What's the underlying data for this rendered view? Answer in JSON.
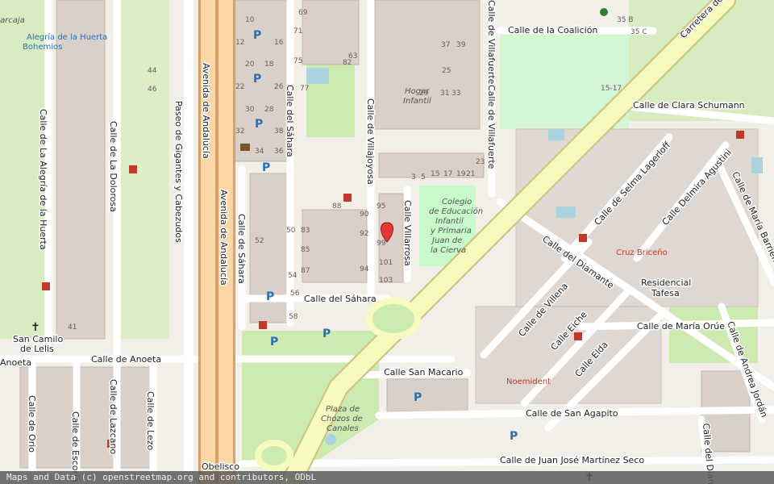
{
  "map": {
    "attribution": "Maps and Data (c) openstreetmap.org and contributors, ODbL",
    "colors": {
      "background": "#f2efe9",
      "building": "#d9d0c9",
      "building_stroke": "#c4b6ab",
      "park": "#c8facc",
      "green": "#cdebb0",
      "road_major": "#fcd6a4",
      "road_major_casing": "#d9a06b",
      "road_secondary": "#f7fabf",
      "road_minor": "#ffffff",
      "water": "#aad3df",
      "poi_red": "#c0392b",
      "poi_blue": "#2a6fb5",
      "marker": "#e53935",
      "parking": "#2a6fb5"
    },
    "streets": [
      {
        "id": "calle-de-la-coalicion",
        "text": "Calle de la Coalición"
      },
      {
        "id": "carretera",
        "text": "Carretera de"
      },
      {
        "id": "calle-de-clara-schumann",
        "text": "Calle de Clara Schumann"
      },
      {
        "id": "calle-de-villafuerte",
        "text": "Calle de Villafuerte"
      },
      {
        "id": "calle-de-villajoyosa",
        "text": "Calle de Villajoyosa"
      },
      {
        "id": "calle-villarrosa",
        "text": "Calle Villarrosa"
      },
      {
        "id": "calle-del-sahara-v",
        "text": "Calle del Sáhara"
      },
      {
        "id": "calle-de-sahara",
        "text": "Calle de Sáhara"
      },
      {
        "id": "calle-del-sahara-h",
        "text": "Calle del Sáhara"
      },
      {
        "id": "avenida-de-andalucia-1",
        "text": "Avenida de Andalucía"
      },
      {
        "id": "avenida-de-andalucia-2",
        "text": "Avenida de Andalucía"
      },
      {
        "id": "paseo-de-gigantes",
        "text": "Paseo de Gigantes y Cabezudos"
      },
      {
        "id": "calle-de-la-dolorosa",
        "text": "Calle de La Dolorosa"
      },
      {
        "id": "calle-de-la-alegria",
        "text": "Calle de La Alegría de la Huerta"
      },
      {
        "id": "calle-de-anoeta",
        "text": "Calle de Anoeta"
      },
      {
        "id": "anoeta",
        "text": "Anoeta"
      },
      {
        "id": "calle-de-orio",
        "text": "Calle de Orio"
      },
      {
        "id": "calle-de-escoriaza",
        "text": "Calle de Escoria"
      },
      {
        "id": "calle-de-lazcano",
        "text": "Calle de Lazcano"
      },
      {
        "id": "calle-de-lezo",
        "text": "Calle de Lezo"
      },
      {
        "id": "calle-san-macario",
        "text": "Calle San Macario"
      },
      {
        "id": "calle-de-san-agapito",
        "text": "Calle de San Agapito"
      },
      {
        "id": "calle-de-juan-jose",
        "text": "Calle de Juan José Martínez Seco"
      },
      {
        "id": "calle-del-diamante",
        "text": "Calle del Diamante"
      },
      {
        "id": "calle-de-villena",
        "text": "Calle de Villena"
      },
      {
        "id": "calle-eiche",
        "text": "Calle Eiche"
      },
      {
        "id": "calle-elda",
        "text": "Calle Elda"
      },
      {
        "id": "calle-de-selma-lagerloff",
        "text": "Calle de Selma Lagerloff"
      },
      {
        "id": "calle-delmira-agustini",
        "text": "Calle Delmira Agustini"
      },
      {
        "id": "calle-de-maria-barrientos",
        "text": "Calle de María Barrientos"
      },
      {
        "id": "calle-de-maria-orue",
        "text": "Calle de María Orúe"
      },
      {
        "id": "calle-de-andrea-jordan",
        "text": "Calle de Andrea Jordán"
      },
      {
        "id": "calle-del-diam",
        "text": "Calle del Diam"
      }
    ],
    "places": [
      {
        "id": "alegria-1",
        "text": "Alegría de la Huerta"
      },
      {
        "id": "alegria-2",
        "text": "Bohemios"
      },
      {
        "id": "hogar-1",
        "text": "Hogar"
      },
      {
        "id": "hogar-2",
        "text": "Infantil"
      },
      {
        "id": "colegio-1",
        "text": "Colegio"
      },
      {
        "id": "colegio-2",
        "text": "de Educación"
      },
      {
        "id": "colegio-3",
        "text": "Infantil"
      },
      {
        "id": "colegio-4",
        "text": "y Primaria"
      },
      {
        "id": "colegio-5",
        "text": "Juan de"
      },
      {
        "id": "colegio-6",
        "text": "la Cierva"
      },
      {
        "id": "cruz-briceno",
        "text": "Cruz Briceño"
      },
      {
        "id": "residencial-1",
        "text": "Residencial"
      },
      {
        "id": "residencial-2",
        "text": "Tafesa"
      },
      {
        "id": "noemident",
        "text": "Noemident"
      },
      {
        "id": "san-camilo-1",
        "text": "San Camilo"
      },
      {
        "id": "san-camilo-2",
        "text": "de Lelis"
      },
      {
        "id": "plaza-1",
        "text": "Plaza de"
      },
      {
        "id": "plaza-2",
        "text": "Chozos de"
      },
      {
        "id": "plaza-3",
        "text": "Canales"
      },
      {
        "id": "obelisco",
        "text": "Obelisco"
      },
      {
        "id": "arcaja",
        "text": "arcaja"
      }
    ],
    "house_numbers": [
      {
        "id": "n-35b",
        "text": "35 B"
      },
      {
        "id": "n-35c",
        "text": "35 C"
      },
      {
        "id": "n-15-17",
        "text": "15-17"
      },
      {
        "id": "n-10",
        "text": "10"
      },
      {
        "id": "n-12",
        "text": "12"
      },
      {
        "id": "n-16",
        "text": "16"
      },
      {
        "id": "n-20",
        "text": "20"
      },
      {
        "id": "n-18",
        "text": "18"
      },
      {
        "id": "n-22",
        "text": "22"
      },
      {
        "id": "n-26",
        "text": "26"
      },
      {
        "id": "n-30",
        "text": "30"
      },
      {
        "id": "n-28",
        "text": "28"
      },
      {
        "id": "n-32",
        "text": "32"
      },
      {
        "id": "n-34",
        "text": "34"
      },
      {
        "id": "n-38",
        "text": "38"
      },
      {
        "id": "n-36",
        "text": "36"
      },
      {
        "id": "n-69",
        "text": "69"
      },
      {
        "id": "n-71",
        "text": "71"
      },
      {
        "id": "n-75",
        "text": "75"
      },
      {
        "id": "n-77",
        "text": "77"
      },
      {
        "id": "n-63",
        "text": "63"
      },
      {
        "id": "n-82",
        "text": "82"
      },
      {
        "id": "n-88",
        "text": "88"
      },
      {
        "id": "n-90",
        "text": "90"
      },
      {
        "id": "n-92",
        "text": "92"
      },
      {
        "id": "n-94",
        "text": "94"
      },
      {
        "id": "n-50",
        "text": "50"
      },
      {
        "id": "n-52",
        "text": "52"
      },
      {
        "id": "n-54",
        "text": "54"
      },
      {
        "id": "n-56",
        "text": "56"
      },
      {
        "id": "n-58",
        "text": "58"
      },
      {
        "id": "n-83",
        "text": "83"
      },
      {
        "id": "n-85",
        "text": "85"
      },
      {
        "id": "n-87",
        "text": "87"
      },
      {
        "id": "n-95",
        "text": "95"
      },
      {
        "id": "n-99",
        "text": "99"
      },
      {
        "id": "n-101",
        "text": "101"
      },
      {
        "id": "n-103",
        "text": "103"
      },
      {
        "id": "n-3",
        "text": "3"
      },
      {
        "id": "n-5",
        "text": "5"
      },
      {
        "id": "n-15",
        "text": "15"
      },
      {
        "id": "n-17",
        "text": "17"
      },
      {
        "id": "n-19",
        "text": "19"
      },
      {
        "id": "n-21",
        "text": "21"
      },
      {
        "id": "n-23",
        "text": "23"
      },
      {
        "id": "n-25",
        "text": "25"
      },
      {
        "id": "n-29",
        "text": "29"
      },
      {
        "id": "n-31",
        "text": "31"
      },
      {
        "id": "n-33",
        "text": "33"
      },
      {
        "id": "n-37",
        "text": "37"
      },
      {
        "id": "n-39",
        "text": "39"
      },
      {
        "id": "n-41",
        "text": "41"
      },
      {
        "id": "n-44",
        "text": "44"
      },
      {
        "id": "n-46",
        "text": "46"
      }
    ]
  }
}
